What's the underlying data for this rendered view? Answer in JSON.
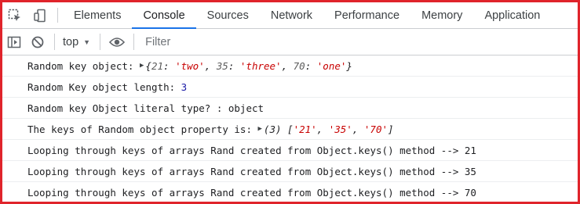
{
  "tabs": [
    {
      "label": "Elements"
    },
    {
      "label": "Console"
    },
    {
      "label": "Sources"
    },
    {
      "label": "Network"
    },
    {
      "label": "Performance"
    },
    {
      "label": "Memory"
    },
    {
      "label": "Application"
    }
  ],
  "active_tab": "Console",
  "toolbar": {
    "context": "top",
    "filter_placeholder": "Filter"
  },
  "log": {
    "row1": {
      "label": "Random key object: ",
      "k1": "21",
      "v1": "'two'",
      "k2": "35",
      "v2": "'three'",
      "k3": "70",
      "v3": "'one'"
    },
    "row2": {
      "label": "Random Key object length: ",
      "value": "3"
    },
    "row3": {
      "label": "Random key Object literal type? : ",
      "value": "object"
    },
    "row4": {
      "label": "The keys of Random object property is: ",
      "count": "(3)",
      "i1": "'21'",
      "i2": "'35'",
      "i3": "'70'"
    },
    "row5": {
      "text": "Looping through keys of arrays Rand created from Object.keys() method --> 21"
    },
    "row6": {
      "text": "Looping through keys of arrays Rand created from Object.keys() method --> 35"
    },
    "row7": {
      "text": "Looping through keys of arrays Rand created from Object.keys() method --> 70"
    }
  },
  "colors": {
    "frame_border": "#e0242b",
    "active_tab_underline": "#1a73e8",
    "string_value": "#c80000",
    "number_value": "#1a1aa6"
  }
}
